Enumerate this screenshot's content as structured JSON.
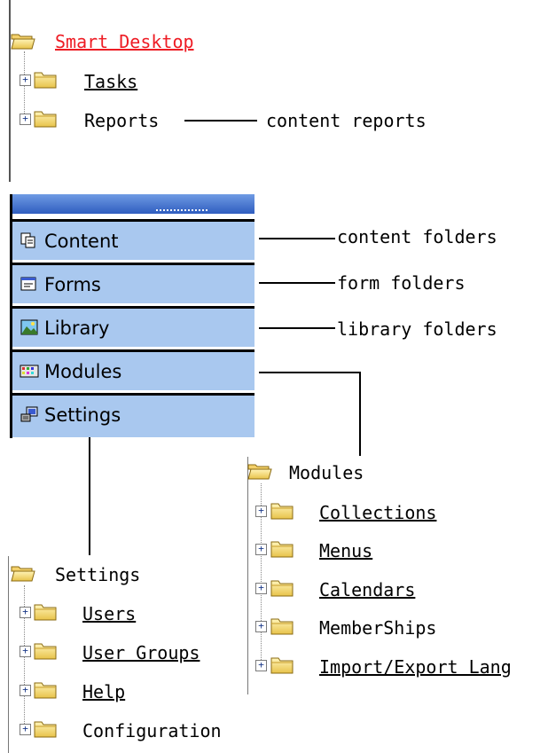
{
  "smart_desktop_tree": {
    "root": "Smart Desktop",
    "items": [
      "Tasks",
      "Reports"
    ]
  },
  "annotations": {
    "reports": "content reports",
    "content": "content folders",
    "forms": "form folders",
    "library": "library folders"
  },
  "panel": {
    "items": [
      "Content",
      "Forms",
      "Library",
      "Modules",
      "Settings"
    ]
  },
  "modules_tree": {
    "root": "Modules",
    "items": [
      "Collections",
      "Menus",
      "Calendars",
      "MemberShips",
      "Import/Export Lang"
    ]
  },
  "settings_tree": {
    "root": "Settings",
    "items": [
      "Users",
      "User Groups",
      "Help",
      "Configuration"
    ]
  }
}
